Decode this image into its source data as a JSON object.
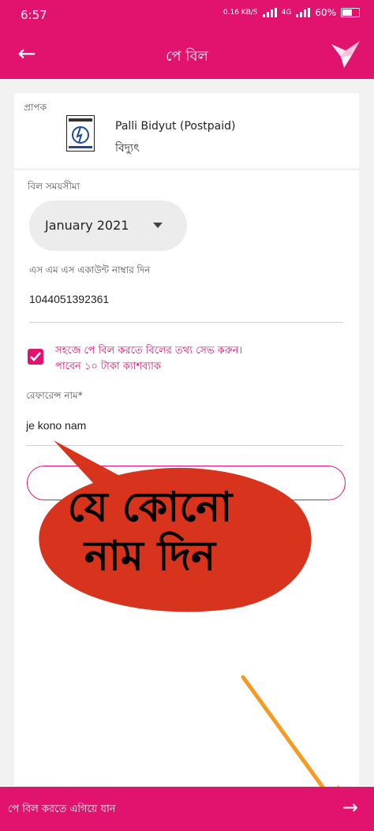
{
  "status_bar": {
    "time": "6:57",
    "data_speed": "0.16 KB/S",
    "network": "4G",
    "battery": "60%"
  },
  "app_bar": {
    "title": "পে বিল"
  },
  "biller": {
    "label": "প্রাপক",
    "name": "Palli Bidyut (Postpaid)",
    "type": "বিদ্যুৎ"
  },
  "bill_period": {
    "label": "বিল সময়সীমা",
    "selected": "January 2021"
  },
  "sms_account": {
    "label": "এস এম এস একাউন্ট নাম্বার দিন",
    "value": "1044051392361"
  },
  "save_info": {
    "checked": true,
    "text": "সহজে পে বিল করতে বিলের তথ্য সেভ করুন। পাবেন ১০ টাকা ক্যাশব্যাক"
  },
  "reference": {
    "label": "রেফারেন্স নাম*",
    "value": "je kono nam"
  },
  "annotation": {
    "callout_text": "যে কোনো নাম দিন",
    "callout_color": "#d8331c",
    "arrow_color": "#f59a23"
  },
  "bottom_bar": {
    "label": "পে বিল করতে এগিয়ে যান"
  },
  "colors": {
    "brand": "#e2136e"
  }
}
